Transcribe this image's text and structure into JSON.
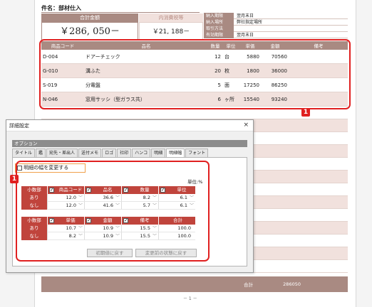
{
  "document": {
    "subject_label": "件名：部材仕入",
    "total_label": "合計金額",
    "tax_label": "内消費税等",
    "total_amount": "￥286, 050－",
    "tax_amount": "￥21, 188－",
    "info": [
      {
        "key": "納入期限",
        "value": "翌月末日"
      },
      {
        "key": "納入場所",
        "value": "弊社指定場所"
      },
      {
        "key": "取引方法",
        "value": ""
      },
      {
        "key": "有効期限",
        "value": "翌月末日"
      }
    ],
    "columns": [
      "商品コード",
      "品名",
      "数量",
      "単位",
      "単価",
      "金額",
      "備考"
    ],
    "rows": [
      {
        "code": "D-004",
        "name": "ドアーチェック",
        "qty": "12",
        "unit": "台",
        "price": "5880",
        "amount": "70560",
        "note": ""
      },
      {
        "code": "G-010",
        "name": "溝ふた",
        "qty": "20",
        "unit": "枚",
        "price": "1800",
        "amount": "36000",
        "note": ""
      },
      {
        "code": "S-019",
        "name": "分電盤",
        "qty": "5",
        "unit": "面",
        "price": "17250",
        "amount": "86250",
        "note": ""
      },
      {
        "code": "N-046",
        "name": "窓用サッシ（型ガラス共）",
        "qty": "6",
        "unit": "ヶ所",
        "price": "15540",
        "amount": "93240",
        "note": ""
      }
    ],
    "footer_total_label": "合計",
    "footer_total_value": "286050",
    "page_number": "－ 1 －"
  },
  "callouts": {
    "badge": "1"
  },
  "dialog": {
    "title": "詳細設定",
    "close": "×",
    "group_title": "オプション",
    "tabs": [
      "タイトル",
      "鑑",
      "宛先・差出人",
      "送付メモ",
      "ロゴ",
      "社印",
      "ハンコ",
      "明細",
      "明細幅",
      "フォント"
    ],
    "active_tab": "明細幅",
    "change_width_label": "明細の幅を変更する",
    "unit_label": "単位:%",
    "upper": {
      "section_label": "小数部",
      "headers": [
        "商品コード",
        "品名",
        "数量",
        "単位"
      ],
      "rows": [
        {
          "label": "あり",
          "values": [
            "12.0",
            "36.6",
            "8.2",
            "6.1"
          ]
        },
        {
          "label": "なし",
          "values": [
            "12.0",
            "41.6",
            "5.7",
            "6.1"
          ]
        }
      ]
    },
    "lower": {
      "section_label": "小数部",
      "headers": [
        "単価",
        "金額",
        "備考",
        "合計"
      ],
      "rows": [
        {
          "label": "あり",
          "values": [
            "10.7",
            "10.9",
            "15.5",
            "100.0"
          ]
        },
        {
          "label": "なし",
          "values": [
            "8.2",
            "10.9",
            "15.5",
            "100.0"
          ]
        }
      ]
    },
    "button_reset_initial": "初期値に戻す",
    "button_reset_before": "変更前の状態に戻す"
  }
}
